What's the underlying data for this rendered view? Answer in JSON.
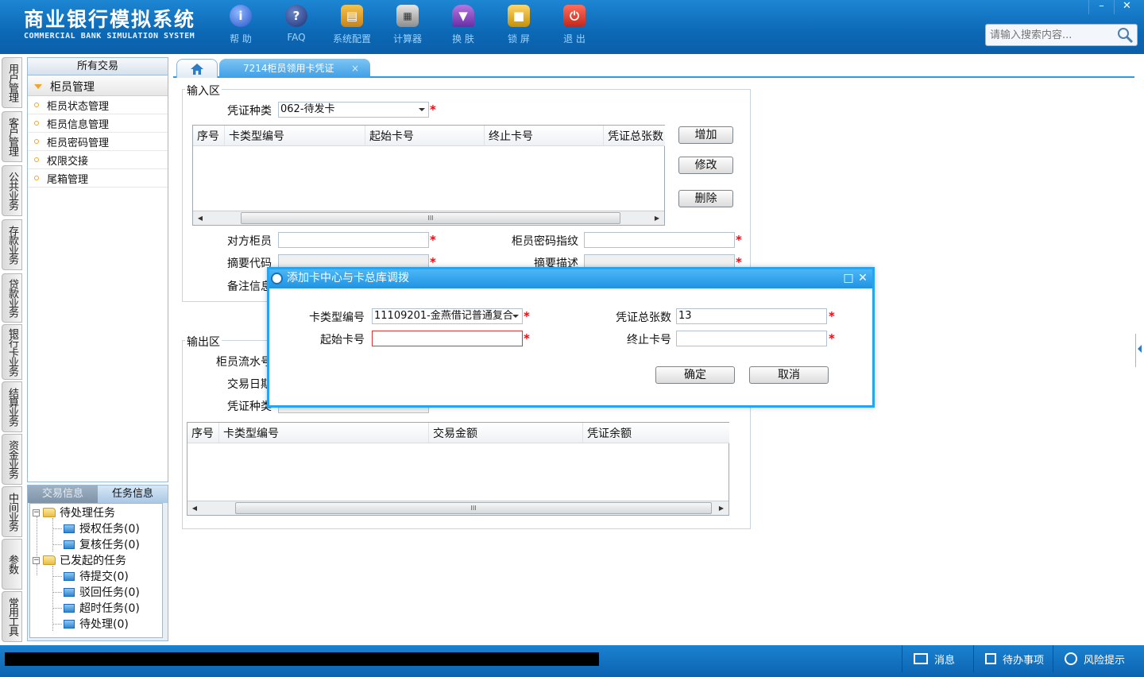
{
  "header": {
    "brand_cn": "商业银行模拟系统",
    "brand_en": "COMMERCIAL BANK SIMULATION SYSTEM",
    "tools": [
      {
        "label": "帮 助",
        "icon": "info-icon"
      },
      {
        "label": "FAQ",
        "icon": "question-icon"
      },
      {
        "label": "系统配置",
        "icon": "toolbox-icon"
      },
      {
        "label": "计算器",
        "icon": "calculator-icon"
      },
      {
        "label": "换 肤",
        "icon": "shirt-icon"
      },
      {
        "label": "锁 屏",
        "icon": "lock-icon"
      },
      {
        "label": "退 出",
        "icon": "power-icon"
      }
    ],
    "search_placeholder": "请输入搜索内容...",
    "window_minimize": "–",
    "window_close": "✕"
  },
  "vtabs": [
    "用户管理",
    "客户管理",
    "公共业务",
    "存款业务",
    "贷款业务",
    "银行卡业务",
    "结算业务",
    "资金业务",
    "中间业务",
    "参数",
    "常用工具"
  ],
  "nav": {
    "header": "所有交易",
    "group": "柜员管理",
    "items": [
      "柜员状态管理",
      "柜员信息管理",
      "柜员密码管理",
      "权限交接",
      "尾箱管理"
    ]
  },
  "tasks": {
    "tab_inactive": "交易信息",
    "tab_active": "任务信息",
    "pending": "待处理任务",
    "pending_children": [
      "授权任务(0)",
      "复核任务(0)"
    ],
    "initiated": "已发起的任务",
    "initiated_children": [
      "待提交(0)",
      "驳回任务(0)",
      "超时任务(0)",
      "待处理(0)"
    ]
  },
  "tabs": {
    "active": "7214柜员领用卡凭证",
    "close": "×"
  },
  "input_area": {
    "legend": "输入区",
    "voucher_type_label": "凭证种类",
    "voucher_type_value": "062-待发卡",
    "columns": [
      "序号",
      "卡类型编号",
      "起始卡号",
      "终止卡号",
      "凭证总张数"
    ],
    "scroll_thumb": "III",
    "add": "增加",
    "modify": "修改",
    "delete": "删除",
    "counterparty_label": "对方柜员",
    "fingerprint_label": "柜员密码指纹",
    "summary_code_label": "摘要代码",
    "summary_desc_label": "摘要描述",
    "remark_label": "备注信息"
  },
  "output_area": {
    "legend": "输出区",
    "serial_label": "柜员流水号",
    "date_label": "交易日期",
    "voucher_label": "凭证种类",
    "columns": [
      "序号",
      "卡类型编号",
      "交易金额",
      "凭证余额"
    ],
    "scroll_thumb": "III"
  },
  "dialog": {
    "title": "添加卡中心与卡总库调拨",
    "card_type_label": "卡类型编号",
    "card_type_value": "11109201-金燕借记普通复合",
    "total_label": "凭证总张数",
    "total_value": "13",
    "start_label": "起始卡号",
    "start_value": "",
    "end_label": "终止卡号",
    "end_value": "",
    "confirm": "确定",
    "cancel": "取消"
  },
  "statusbar": {
    "message": "消息",
    "todo": "待办事项",
    "risk": "风险提示"
  },
  "colors": {
    "header_blue": "#0c68b5",
    "accent": "#27a4ee",
    "required": "#e0101a"
  }
}
